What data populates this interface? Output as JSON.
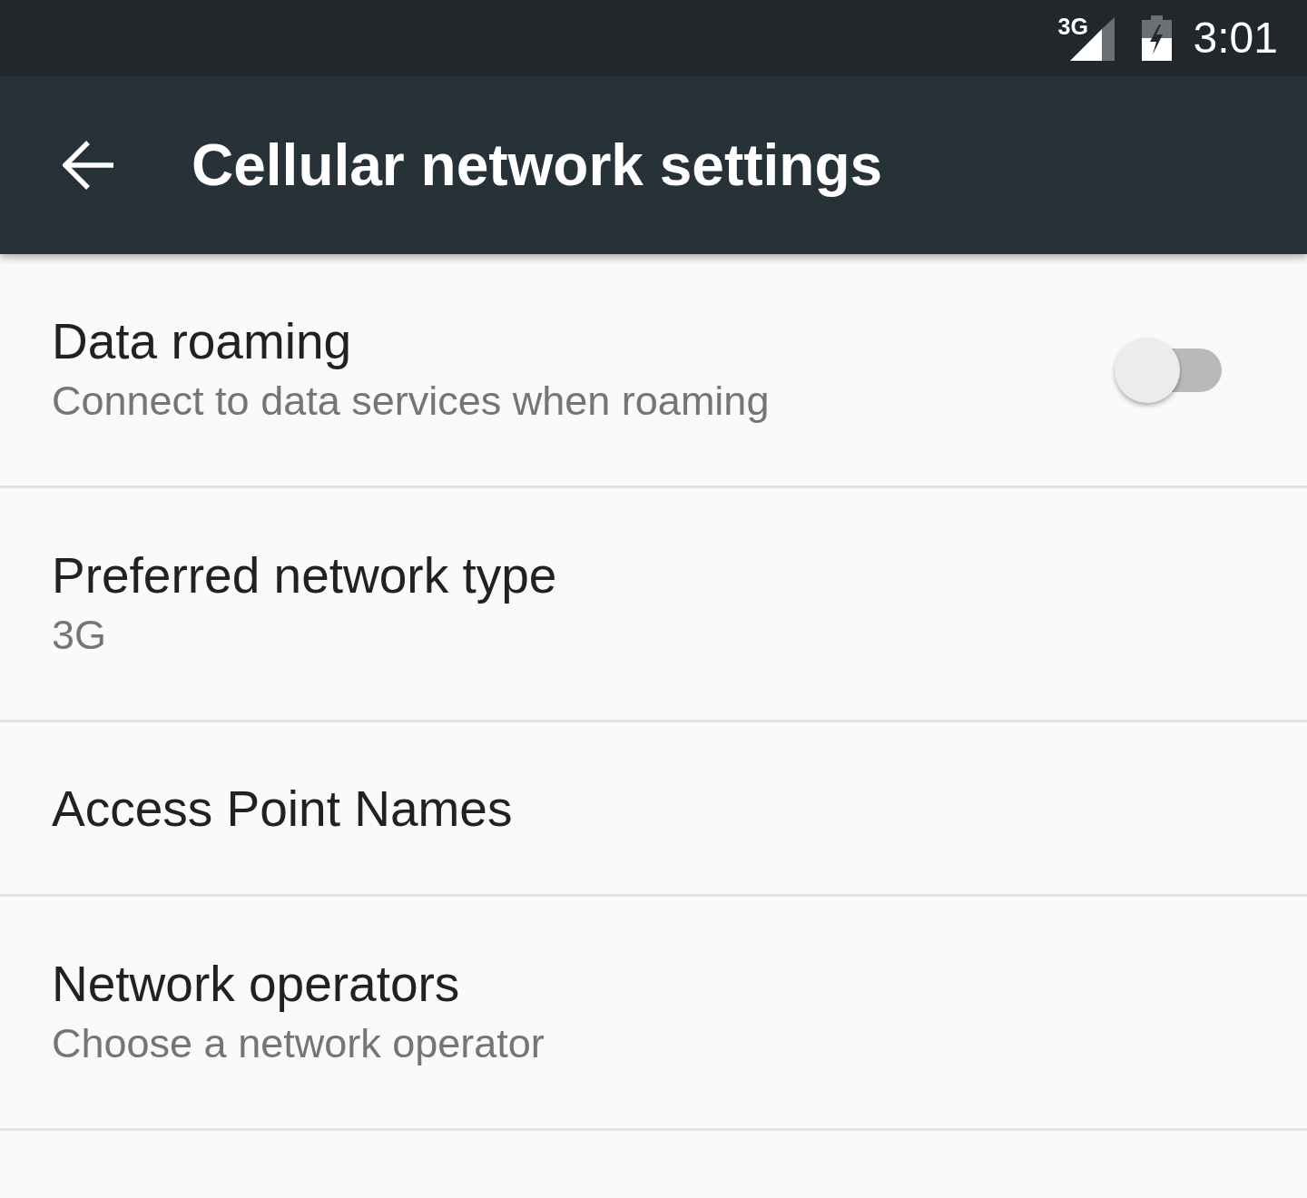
{
  "status_bar": {
    "network_type": "3G",
    "time": "3:01"
  },
  "app_bar": {
    "title": "Cellular network settings"
  },
  "settings": [
    {
      "kind": "switch",
      "title": "Data roaming",
      "summary": "Connect to data services when roaming",
      "on": false
    },
    {
      "kind": "plain",
      "title": "Preferred network type",
      "summary": "3G"
    },
    {
      "kind": "plain",
      "title": "Access Point Names"
    },
    {
      "kind": "plain",
      "title": "Network operators",
      "summary": "Choose a network operator"
    }
  ]
}
